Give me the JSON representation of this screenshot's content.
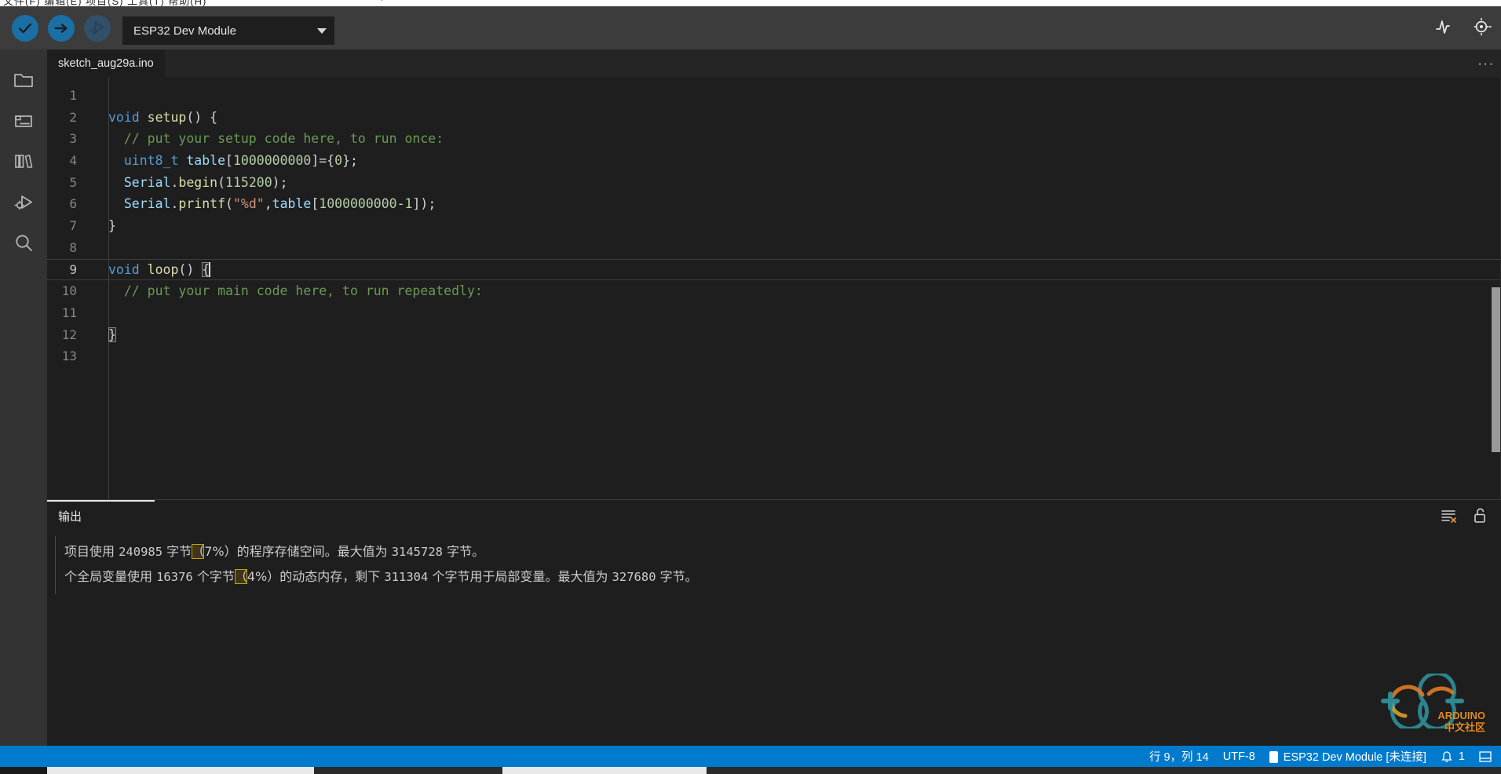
{
  "window": {
    "menubar_glyphs": "文件(F)  编辑(E)  项目(S)  工具(T)  帮助(H)"
  },
  "toolbar": {
    "verify_label": "Verify",
    "upload_label": "Upload",
    "debug_label": "Debug",
    "board_selector_value": "ESP32 Dev Module",
    "serial_plotter_label": "Serial Plotter",
    "serial_monitor_label": "Serial Monitor"
  },
  "sidebar": {
    "items": [
      {
        "name": "sketchbook",
        "icon": "folder-icon"
      },
      {
        "name": "boards-manager",
        "icon": "boards-icon"
      },
      {
        "name": "library-manager",
        "icon": "books-icon"
      },
      {
        "name": "debug",
        "icon": "debug-icon"
      },
      {
        "name": "search",
        "icon": "search-icon"
      }
    ]
  },
  "editor": {
    "tab_title": "sketch_aug29a.ino",
    "more_actions": "···",
    "lines": [
      {
        "n": "1",
        "tokens": []
      },
      {
        "n": "2",
        "tokens": [
          {
            "t": "void ",
            "c": "t-kw"
          },
          {
            "t": "setup",
            "c": "t-fn"
          },
          {
            "t": "() {",
            "c": "t-plain"
          }
        ]
      },
      {
        "n": "3",
        "tokens": [
          {
            "t": "  // put your setup code here, to run once:",
            "c": "t-com"
          }
        ]
      },
      {
        "n": "4",
        "tokens": [
          {
            "t": "  ",
            "c": "t-plain"
          },
          {
            "t": "uint8_t",
            "c": "t-kw"
          },
          {
            "t": " ",
            "c": "t-plain"
          },
          {
            "t": "table",
            "c": "t-var"
          },
          {
            "t": "[",
            "c": "t-plain"
          },
          {
            "t": "1000000000",
            "c": "t-num"
          },
          {
            "t": "]={",
            "c": "t-plain"
          },
          {
            "t": "0",
            "c": "t-num"
          },
          {
            "t": "};",
            "c": "t-plain"
          }
        ]
      },
      {
        "n": "5",
        "tokens": [
          {
            "t": "  ",
            "c": "t-plain"
          },
          {
            "t": "Serial",
            "c": "t-var"
          },
          {
            "t": ".",
            "c": "t-plain"
          },
          {
            "t": "begin",
            "c": "t-fn"
          },
          {
            "t": "(",
            "c": "t-plain"
          },
          {
            "t": "115200",
            "c": "t-num"
          },
          {
            "t": ");",
            "c": "t-plain"
          }
        ]
      },
      {
        "n": "6",
        "tokens": [
          {
            "t": "  ",
            "c": "t-plain"
          },
          {
            "t": "Serial",
            "c": "t-var"
          },
          {
            "t": ".",
            "c": "t-plain"
          },
          {
            "t": "printf",
            "c": "t-fn"
          },
          {
            "t": "(",
            "c": "t-plain"
          },
          {
            "t": "\"%d\"",
            "c": "t-str"
          },
          {
            "t": ",",
            "c": "t-plain"
          },
          {
            "t": "table",
            "c": "t-var"
          },
          {
            "t": "[",
            "c": "t-plain"
          },
          {
            "t": "1000000000",
            "c": "t-num"
          },
          {
            "t": "-",
            "c": "t-plain"
          },
          {
            "t": "1",
            "c": "t-num"
          },
          {
            "t": "]);",
            "c": "t-plain"
          }
        ]
      },
      {
        "n": "7",
        "tokens": [
          {
            "t": "}",
            "c": "t-plain"
          }
        ]
      },
      {
        "n": "8",
        "tokens": []
      },
      {
        "n": "9",
        "tokens": [
          {
            "t": "void ",
            "c": "t-kw"
          },
          {
            "t": "loop",
            "c": "t-fn"
          },
          {
            "t": "() ",
            "c": "t-plain"
          },
          {
            "t": "{",
            "c": "t-plain",
            "match": true
          },
          {
            "t": "",
            "c": "caret"
          }
        ],
        "active": true
      },
      {
        "n": "10",
        "tokens": [
          {
            "t": "  // put your main code here, to run repeatedly:",
            "c": "t-com"
          }
        ]
      },
      {
        "n": "11",
        "tokens": []
      },
      {
        "n": "12",
        "tokens": [
          {
            "t": "}",
            "c": "t-plain",
            "match": true
          }
        ]
      },
      {
        "n": "13",
        "tokens": []
      }
    ]
  },
  "output_panel": {
    "tab_label": "输出",
    "clear_icon": "clear-output-icon",
    "lock_icon": "unlock-scroll-icon",
    "lines": [
      [
        {
          "t": "项目使用 "
        },
        {
          "t": "240985",
          "mono": true
        },
        {
          "t": " 字节"
        },
        {
          "t": "（",
          "hl": true
        },
        {
          "t": "7%）的程序存储空间。最大值为 "
        },
        {
          "t": "3145728",
          "mono": true
        },
        {
          "t": " 字节。"
        }
      ],
      [
        {
          "t": "个全局变量使用 "
        },
        {
          "t": "16376",
          "mono": true
        },
        {
          "t": " 个字节"
        },
        {
          "t": "（",
          "hl": true
        },
        {
          "t": "4%）的动态内存，剩下 "
        },
        {
          "t": "311304",
          "mono": true
        },
        {
          "t": " 个字节用于局部变量。最大值为 "
        },
        {
          "t": "327680",
          "mono": true
        },
        {
          "t": " 字节。"
        }
      ]
    ]
  },
  "statusbar": {
    "cursor_position": "行 9，列 14",
    "encoding": "UTF-8",
    "board_status": "ESP32 Dev Module [未连接]",
    "notifications": "1",
    "background_color": "#007acc"
  },
  "watermark": {
    "line1": "ARDUINO",
    "line2": "中文社区"
  }
}
